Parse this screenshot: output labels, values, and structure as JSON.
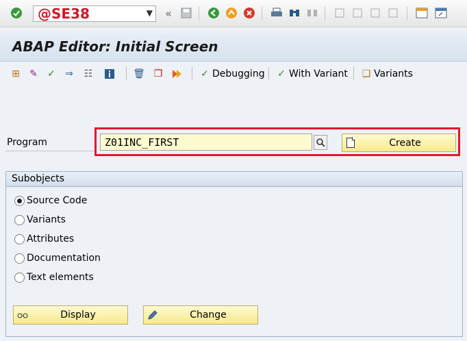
{
  "command_field": {
    "value": "@SE38"
  },
  "title": "ABAP Editor: Initial Screen",
  "app_toolbar": {
    "debugging_label": "Debugging",
    "with_variant_label": "With Variant",
    "variants_label": "Variants"
  },
  "program": {
    "label": "Program",
    "value": "Z01INC_FIRST",
    "create_label": "Create"
  },
  "subobjects": {
    "title": "Subobjects",
    "options": [
      "Source Code",
      "Variants",
      "Attributes",
      "Documentation",
      "Text elements"
    ],
    "selected": "Source Code"
  },
  "actions": {
    "display_label": "Display",
    "change_label": "Change"
  },
  "colors": {
    "command_text": "#d0172b",
    "highlight_box": "#e0182c",
    "input_bg": "#fffbd0",
    "button_bg": "#f8e98c"
  }
}
